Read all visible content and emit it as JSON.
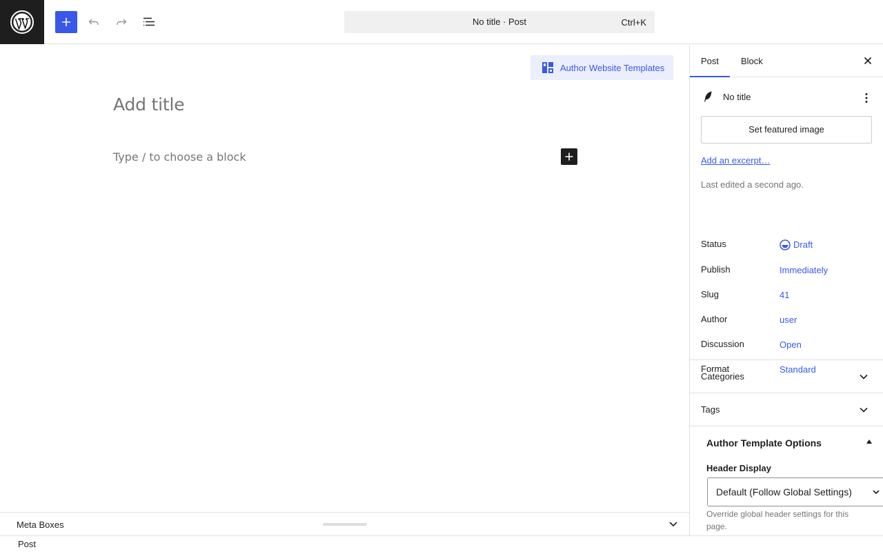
{
  "toolbar": {
    "logo_icon": "wordpress-logo-icon",
    "inserter_icon": "plus-icon",
    "undo_icon": "undo-icon",
    "redo_icon": "redo-icon",
    "document_overview_icon": "list-view-icon",
    "command_bar": {
      "title": "No title · Post",
      "shortcut": "Ctrl+K"
    }
  },
  "canvas": {
    "templates_button": "Author Website Templates",
    "title_placeholder": "Add title",
    "block_placeholder": "Type / to choose a block",
    "add_block_icon": "plus-icon"
  },
  "meta_boxes": {
    "label": "Meta Boxes",
    "toggle_icon": "chevron-down-icon"
  },
  "status_bar": {
    "breadcrumb": "Post"
  },
  "sidebar": {
    "tabs": [
      "Post",
      "Block"
    ],
    "active_tab": "Post",
    "close_icon": "close-icon",
    "summary": {
      "post_icon": "feather-icon",
      "title": "No title",
      "more_icon": "more-vertical-icon",
      "featured_image_button": "Set featured image",
      "excerpt_link": "Add an excerpt…",
      "last_edited": "Last edited a second ago.",
      "fields": [
        {
          "key": "Status",
          "value": "Draft",
          "icon": "draft-icon"
        },
        {
          "key": "Publish",
          "value": "Immediately"
        },
        {
          "key": "Slug",
          "value": "41"
        },
        {
          "key": "Author",
          "value": "user"
        },
        {
          "key": "Discussion",
          "value": "Open"
        },
        {
          "key": "Format",
          "value": "Standard"
        }
      ]
    },
    "panels": [
      {
        "title": "Categories",
        "expanded": false
      },
      {
        "title": "Tags",
        "expanded": false
      }
    ],
    "author_template_options": {
      "title": "Author Template Options",
      "expanded": true,
      "header_display_label": "Header Display",
      "header_display_value": "Default (Follow Global Settings)",
      "help": "Override global header settings for this page."
    }
  },
  "colors": {
    "accent": "#3858e9",
    "dark": "#1e1e1e",
    "muted_text": "#757575",
    "border": "#e0e0e0"
  }
}
